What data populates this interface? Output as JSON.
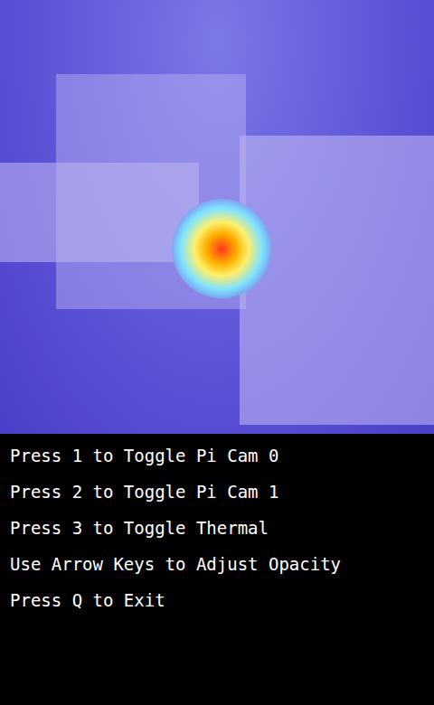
{
  "instructions": [
    "Press 1 to Toggle Pi Cam 0",
    "Press 2 to Toggle Pi Cam 1",
    "Press 3 to Toggle Thermal",
    "Use Arrow Keys to Adjust Opacity",
    "Press Q to Exit"
  ]
}
